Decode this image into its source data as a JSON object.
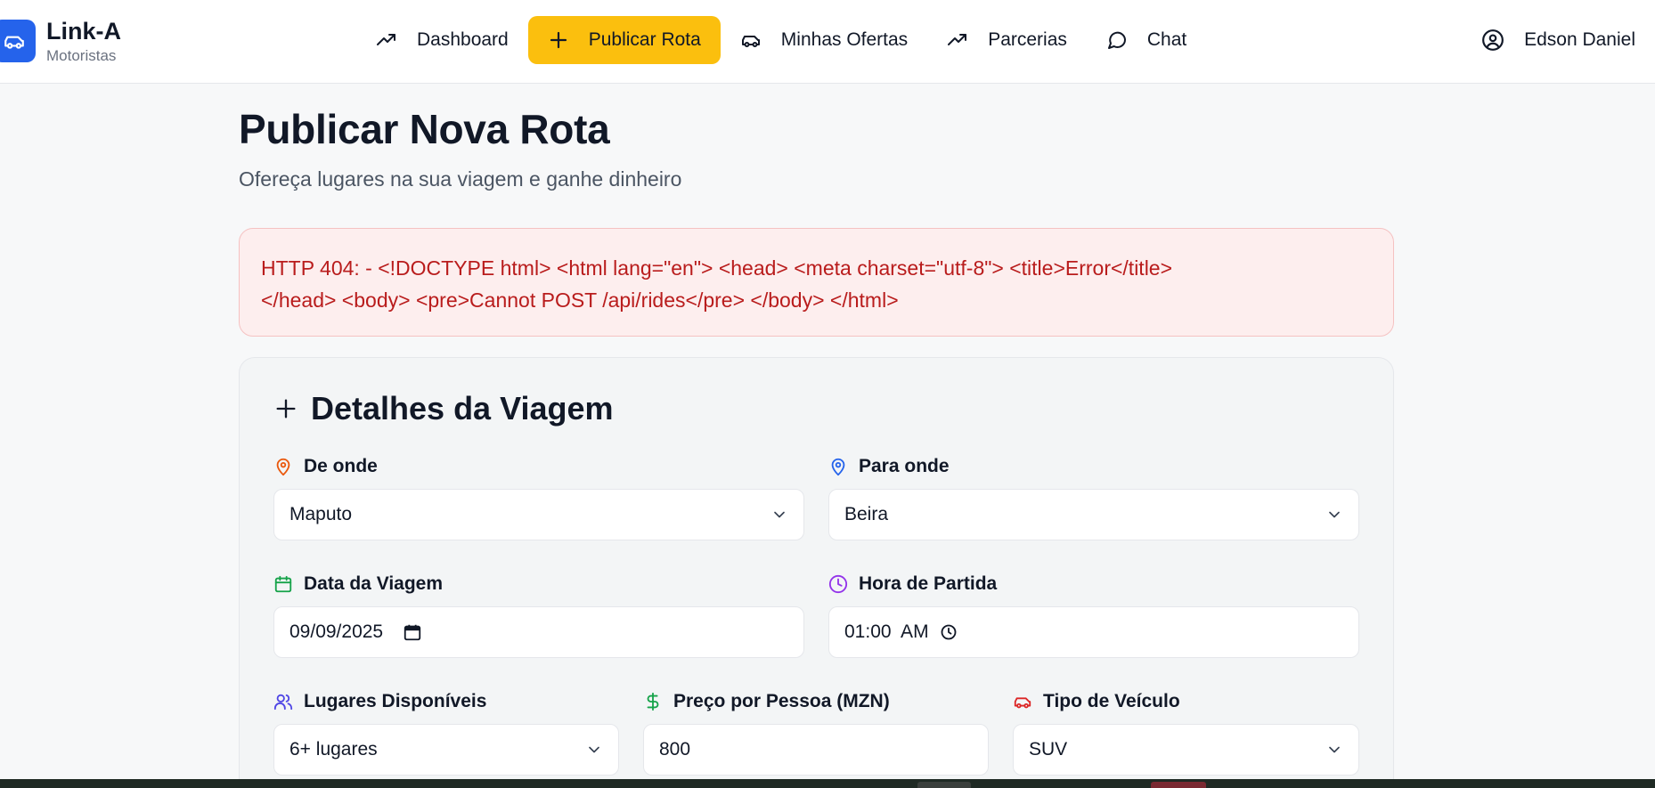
{
  "brand": {
    "name": "Link-A",
    "subtitle": "Motoristas",
    "icon": "car-icon",
    "color": "#2563eb"
  },
  "nav": {
    "items": [
      {
        "label": "Dashboard",
        "icon": "trending-up-icon",
        "active": false
      },
      {
        "label": "Publicar Rota",
        "icon": "plus-icon",
        "active": true
      },
      {
        "label": "Minhas Ofertas",
        "icon": "car-icon",
        "active": false
      },
      {
        "label": "Parcerias",
        "icon": "trending-up-icon",
        "active": false
      },
      {
        "label": "Chat",
        "icon": "message-circle-icon",
        "active": false
      }
    ],
    "active_color": "#fbbf0e"
  },
  "user": {
    "name": "Edson Daniel",
    "icon": "user-circle-icon"
  },
  "page": {
    "title": "Publicar Nova Rota",
    "subtitle": "Ofereça lugares na sua viagem e ganhe dinheiro"
  },
  "error": {
    "line1": "HTTP 404: - <!DOCTYPE html> <html lang=\"en\"> <head> <meta charset=\"utf-8\"> <title>Error</title>",
    "line2": "</head> <body> <pre>Cannot POST /api/rides</pre> </body> </html>",
    "color": "#b91c1c"
  },
  "form": {
    "title": "Detalhes da Viagem",
    "from": {
      "label": "De onde",
      "value": "Maputo",
      "icon": "map-pin-icon",
      "icon_color": "#ea580c"
    },
    "to": {
      "label": "Para onde",
      "value": "Beira",
      "icon": "map-pin-icon",
      "icon_color": "#2563eb"
    },
    "date": {
      "label": "Data da Viagem",
      "value": "09/09/2025",
      "icon": "calendar-icon",
      "icon_color": "#16a34a"
    },
    "time": {
      "label": "Hora de Partida",
      "value": "01:00  AM",
      "icon": "clock-icon",
      "icon_color": "#9333ea"
    },
    "seats": {
      "label": "Lugares Disponíveis",
      "value": "6+ lugares",
      "icon": "users-icon",
      "icon_color": "#4f46e5"
    },
    "price": {
      "label": "Preço por Pessoa (MZN)",
      "value": "800",
      "icon": "dollar-icon",
      "icon_color": "#16a34a"
    },
    "vehicle": {
      "label": "Tipo de Veículo",
      "value": "SUV",
      "icon": "car-icon",
      "icon_color": "#dc2626"
    }
  }
}
